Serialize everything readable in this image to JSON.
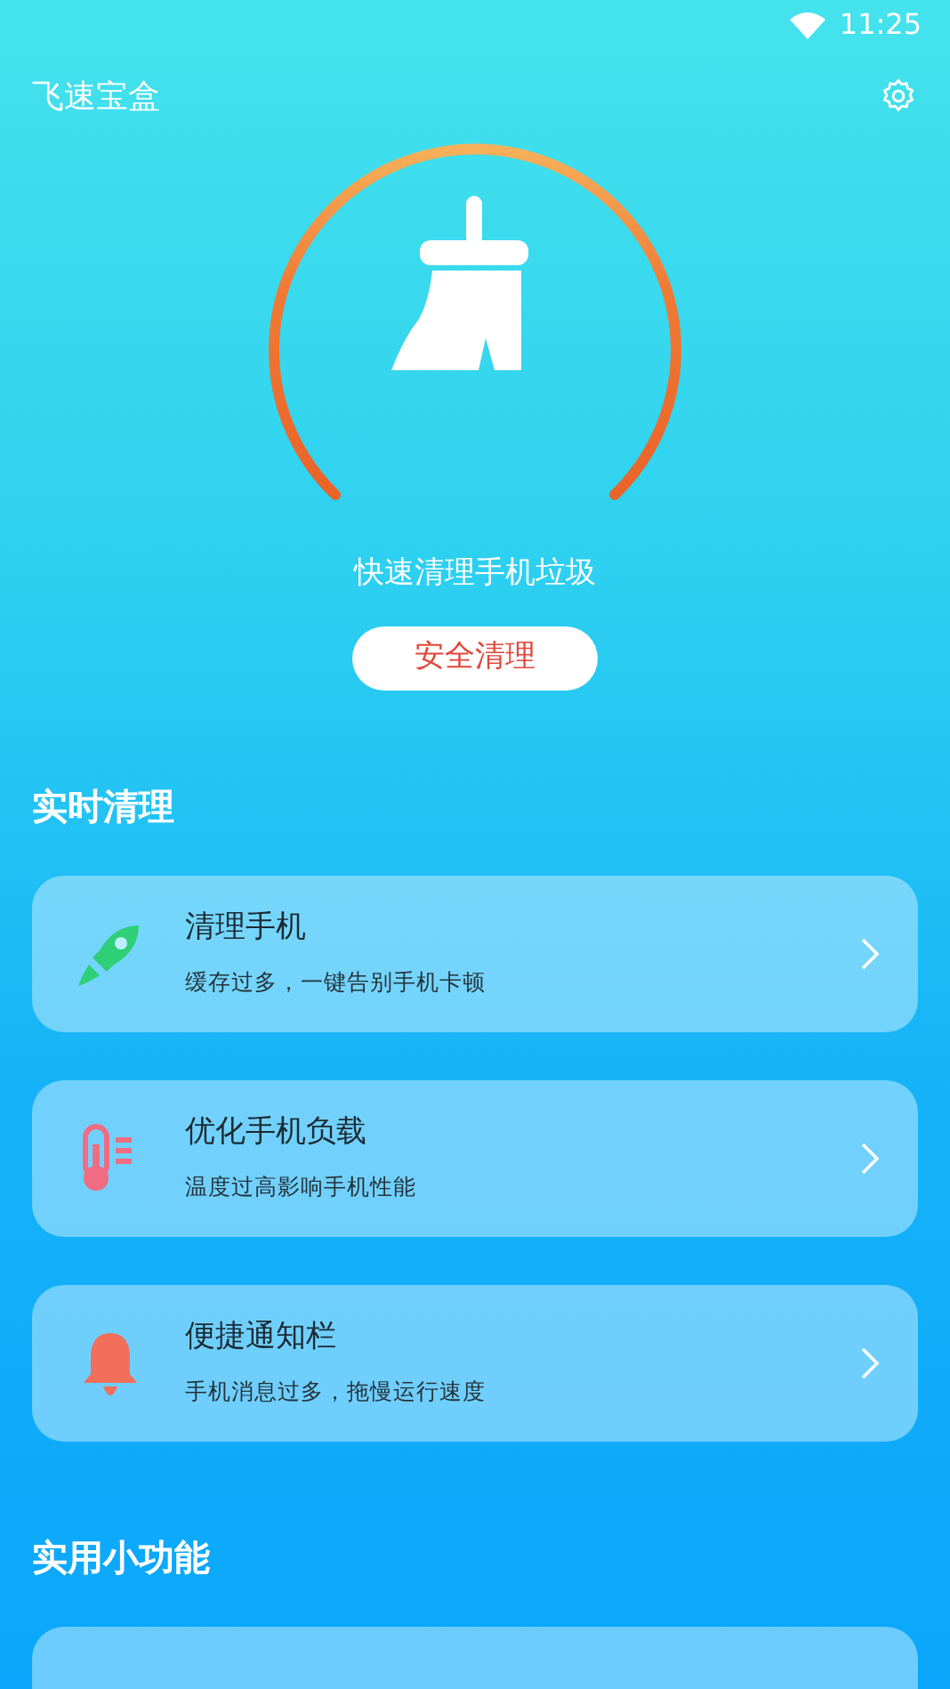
{
  "status_bar": {
    "time": "11:25"
  },
  "app_bar": {
    "title": "飞速宝盒"
  },
  "hero": {
    "caption": "快速清理手机垃圾",
    "button": "安全清理"
  },
  "sections": [
    {
      "title": "实时清理",
      "items": [
        {
          "kind": "rocket",
          "title": "清理手机",
          "subtitle": "缓存过多，一键告别手机卡顿"
        },
        {
          "kind": "thermometer",
          "title": "优化手机负载",
          "subtitle": "温度过高影响手机性能"
        },
        {
          "kind": "bell",
          "title": "便捷通知栏",
          "subtitle": "手机消息过多，拖慢运行速度"
        }
      ]
    },
    {
      "title": "实用小功能",
      "items": [
        {
          "kind": "partial"
        }
      ]
    }
  ]
}
